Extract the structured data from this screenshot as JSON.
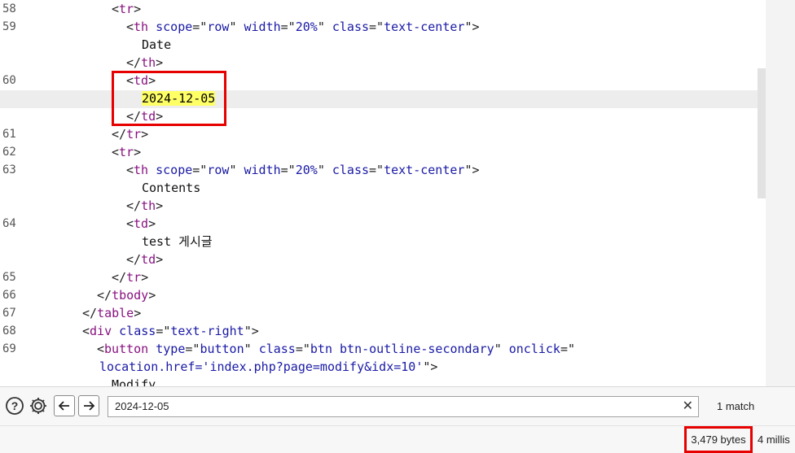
{
  "code": {
    "lines": [
      {
        "ln": "58",
        "parts": [
          [
            "br",
            "<"
          ],
          [
            "tag",
            "tr"
          ],
          [
            "br",
            ">"
          ]
        ]
      },
      {
        "ln": "59",
        "parts": [
          [
            "br",
            "<"
          ],
          [
            "tag",
            "th "
          ],
          [
            "attr",
            "scope"
          ],
          [
            "br",
            "=\""
          ],
          [
            "val",
            "row"
          ],
          [
            "br",
            "\" "
          ],
          [
            "attr",
            "width"
          ],
          [
            "br",
            "=\""
          ],
          [
            "val",
            "20%"
          ],
          [
            "br",
            "\" "
          ],
          [
            "attr",
            "class"
          ],
          [
            "br",
            "=\""
          ],
          [
            "val",
            "text-center"
          ],
          [
            "br",
            "\">"
          ]
        ]
      },
      {
        "ln": "",
        "parts": [
          [
            "plain",
            "Date"
          ]
        ]
      },
      {
        "ln": "",
        "parts": [
          [
            "br",
            "</"
          ],
          [
            "tag",
            "th"
          ],
          [
            "br",
            ">"
          ]
        ]
      },
      {
        "ln": "60",
        "parts": [
          [
            "br",
            "<"
          ],
          [
            "tag",
            "td"
          ],
          [
            "br",
            ">"
          ]
        ]
      },
      {
        "ln": "",
        "parts": [
          [
            "hl",
            "2024-12-05"
          ]
        ]
      },
      {
        "ln": "",
        "parts": [
          [
            "br",
            "</"
          ],
          [
            "tag",
            "td"
          ],
          [
            "br",
            ">"
          ]
        ]
      },
      {
        "ln": "61",
        "parts": [
          [
            "br",
            "</"
          ],
          [
            "tag",
            "tr"
          ],
          [
            "br",
            ">"
          ]
        ]
      },
      {
        "ln": "62",
        "parts": [
          [
            "br",
            "<"
          ],
          [
            "tag",
            "tr"
          ],
          [
            "br",
            ">"
          ]
        ]
      },
      {
        "ln": "63",
        "parts": [
          [
            "br",
            "<"
          ],
          [
            "tag",
            "th "
          ],
          [
            "attr",
            "scope"
          ],
          [
            "br",
            "=\""
          ],
          [
            "val",
            "row"
          ],
          [
            "br",
            "\" "
          ],
          [
            "attr",
            "width"
          ],
          [
            "br",
            "=\""
          ],
          [
            "val",
            "20%"
          ],
          [
            "br",
            "\" "
          ],
          [
            "attr",
            "class"
          ],
          [
            "br",
            "=\""
          ],
          [
            "val",
            "text-center"
          ],
          [
            "br",
            "\">"
          ]
        ]
      },
      {
        "ln": "",
        "parts": [
          [
            "plain",
            "Contents"
          ]
        ]
      },
      {
        "ln": "",
        "parts": [
          [
            "br",
            "</"
          ],
          [
            "tag",
            "th"
          ],
          [
            "br",
            ">"
          ]
        ]
      },
      {
        "ln": "64",
        "parts": [
          [
            "br",
            "<"
          ],
          [
            "tag",
            "td"
          ],
          [
            "br",
            ">"
          ]
        ]
      },
      {
        "ln": "",
        "parts": [
          [
            "plain",
            "test 게시글"
          ]
        ]
      },
      {
        "ln": "",
        "parts": [
          [
            "br",
            "</"
          ],
          [
            "tag",
            "td"
          ],
          [
            "br",
            ">"
          ]
        ]
      },
      {
        "ln": "65",
        "parts": [
          [
            "br",
            "</"
          ],
          [
            "tag",
            "tr"
          ],
          [
            "br",
            ">"
          ]
        ]
      },
      {
        "ln": "66",
        "parts": [
          [
            "br",
            "</"
          ],
          [
            "tag",
            "tbody"
          ],
          [
            "br",
            ">"
          ]
        ]
      },
      {
        "ln": "67",
        "parts": [
          [
            "br",
            "</"
          ],
          [
            "tag",
            "table"
          ],
          [
            "br",
            ">"
          ]
        ]
      },
      {
        "ln": "68",
        "parts": [
          [
            "br",
            "<"
          ],
          [
            "tag",
            "div "
          ],
          [
            "attr",
            "class"
          ],
          [
            "br",
            "=\""
          ],
          [
            "val",
            "text-right"
          ],
          [
            "br",
            "\">"
          ]
        ]
      },
      {
        "ln": "69",
        "parts": [
          [
            "br",
            "<"
          ],
          [
            "tag",
            "button "
          ],
          [
            "attr",
            "type"
          ],
          [
            "br",
            "=\""
          ],
          [
            "val",
            "button"
          ],
          [
            "br",
            "\" "
          ],
          [
            "attr",
            "class"
          ],
          [
            "br",
            "=\""
          ],
          [
            "val",
            "btn btn-outline-secondary"
          ],
          [
            "br",
            "\" "
          ],
          [
            "attr",
            "onclick"
          ],
          [
            "br",
            "=\""
          ]
        ]
      },
      {
        "ln": "",
        "parts": [
          [
            "val",
            "location.href='index.php?page=modify&idx=10'"
          ],
          [
            "br",
            "\">"
          ]
        ]
      },
      {
        "ln": "",
        "parts": [
          [
            "plain",
            "Modify"
          ]
        ]
      }
    ]
  },
  "findbar": {
    "help_icon": "help-icon",
    "settings_icon": "gear-icon",
    "prev_icon": "arrow-left-icon",
    "next_icon": "arrow-right-icon",
    "search_value": "2024-12-05",
    "clear_label": "✕",
    "match_count": "1 match"
  },
  "status": {
    "bytes": "3,479 bytes",
    "millis": "4 millis"
  },
  "colors": {
    "highlight": "#ffff66",
    "annotation_box": "#e60000",
    "tag": "#881280",
    "attribute": "#1a1aa6"
  }
}
